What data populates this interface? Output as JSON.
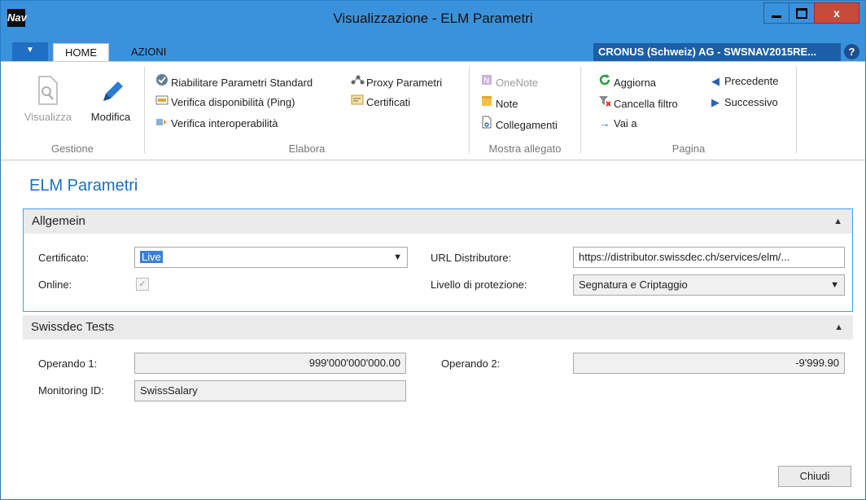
{
  "window": {
    "title": "Visualizzazione - ELM Parametri",
    "app_icon": "Nav",
    "controls": {
      "minimize": "minimize-icon",
      "maximize": "maximize-icon",
      "close": "x"
    }
  },
  "tabs": {
    "menu_glyph": "▼",
    "home": "HOME",
    "azioni": "AZIONI",
    "company": "CRONUS (Schweiz) AG - SWSNAV2015RE...",
    "help": "?"
  },
  "ribbon": {
    "gestione": {
      "label": "Gestione",
      "visualizza": "Visualizza",
      "modifica": "Modifica"
    },
    "elabora": {
      "label": "Elabora",
      "riabilitare": "Riabilitare Parametri Standard",
      "verifica_ping": "Verifica disponibilità (Ping)",
      "verifica_inter": "Verifica interoperabilità",
      "proxy": "Proxy Parametri",
      "certificati": "Certificati"
    },
    "allegato": {
      "label": "Mostra allegato",
      "onenote": "OneNote",
      "note": "Note",
      "collegamenti": "Collegamenti"
    },
    "pagina": {
      "label": "Pagina",
      "aggiorna": "Aggiorna",
      "cancella": "Cancella filtro",
      "vai": "Vai a",
      "precedente": "Precedente",
      "successivo": "Successivo"
    }
  },
  "page": {
    "title": "ELM Parametri"
  },
  "allgemein": {
    "header": "Allgemein",
    "certificato_label": "Certificato:",
    "certificato_value": "Live",
    "online_label": "Online:",
    "online_checked": true,
    "url_label": "URL Distributore:",
    "url_value": "https://distributor.swissdec.ch/services/elm/...",
    "livello_label": "Livello di protezione:",
    "livello_value": "Segnatura e Criptaggio"
  },
  "swissdec": {
    "header": "Swissdec Tests",
    "op1_label": "Operando 1:",
    "op1_value": "999'000'000'000.00",
    "op2_label": "Operando 2:",
    "op2_value": "-9'999.90",
    "monitoring_label": "Monitoring ID:",
    "monitoring_value": "SwissSalary"
  },
  "footer": {
    "chiudi": "Chiudi"
  },
  "colors": {
    "titlebar": "#3b92dc",
    "accent_title": "#1a6fc2",
    "company_bg": "#1c5fa8"
  }
}
